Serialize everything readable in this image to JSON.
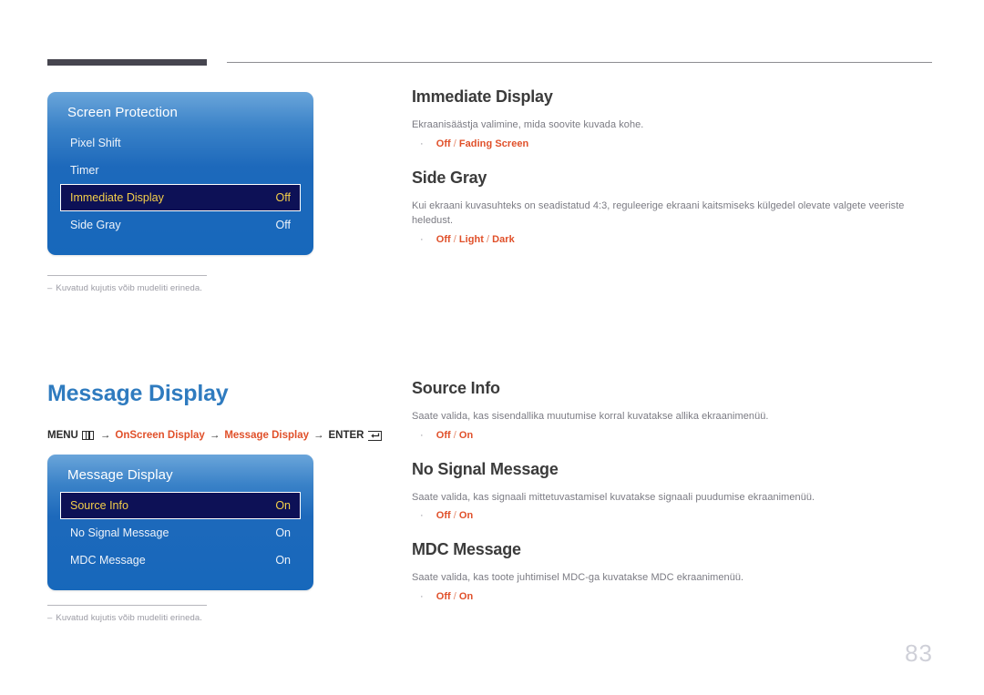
{
  "header": {
    "rule_accent_color": "#46454f",
    "rule_line_color": "#8d8d92"
  },
  "page": {
    "number": "83",
    "number_color": "#cfd0d8"
  },
  "osd_panels": [
    {
      "id": "screen-protection",
      "title": "Screen Protection",
      "rows": [
        {
          "label": "Pixel Shift",
          "value": "",
          "selected": false
        },
        {
          "label": "Timer",
          "value": "",
          "selected": false
        },
        {
          "label": "Immediate Display",
          "value": "Off",
          "selected": true
        },
        {
          "label": "Side Gray",
          "value": "Off",
          "selected": false
        }
      ]
    },
    {
      "id": "message-display",
      "title": "Message Display",
      "rows": [
        {
          "label": "Source Info",
          "value": "On",
          "selected": true
        },
        {
          "label": "No Signal Message",
          "value": "On",
          "selected": false
        },
        {
          "label": "MDC Message",
          "value": "On",
          "selected": false
        }
      ]
    }
  ],
  "notes": {
    "dash": "–",
    "text": "Kuvatud kujutis võib mudeliti erineda."
  },
  "section": {
    "title": "Message Display",
    "title_color": "#2f7bbf",
    "breadcrumb": {
      "menu_label": "MENU",
      "arrow": "→",
      "path_1": "OnScreen Display",
      "path_2": "Message Display",
      "enter_label": "ENTER",
      "accent_color": "#e0502a"
    }
  },
  "content_top": {
    "items": [
      {
        "heading": "Immediate Display",
        "description": "Ekraanisäästja valimine, mida soovite kuvada kohe.",
        "bullet": "·",
        "options": [
          "Off",
          "Fading Screen"
        ],
        "separator": "/"
      },
      {
        "heading": "Side Gray",
        "description": "Kui ekraani kuvasuhteks on seadistatud 4:3, reguleerige ekraani kaitsmiseks külgedel olevate valgete veeriste heledust.",
        "bullet": "·",
        "options": [
          "Off",
          "Light",
          "Dark"
        ],
        "separator": "/"
      }
    ]
  },
  "content_bottom": {
    "items": [
      {
        "heading": "Source Info",
        "description": "Saate valida, kas sisendallika muutumise korral kuvatakse allika ekraanimenüü.",
        "bullet": "·",
        "options": [
          "Off",
          "On"
        ],
        "separator": "/"
      },
      {
        "heading": "No Signal Message",
        "description": "Saate valida, kas signaali mittetuvastamisel kuvatakse signaali puudumise ekraanimenüü.",
        "bullet": "·",
        "options": [
          "Off",
          "On"
        ],
        "separator": "/"
      },
      {
        "heading": "MDC Message",
        "description": "Saate valida, kas toote juhtimisel MDC-ga kuvatakse MDC ekraanimenüü.",
        "bullet": "·",
        "options": [
          "Off",
          "On"
        ],
        "separator": "/"
      }
    ]
  }
}
